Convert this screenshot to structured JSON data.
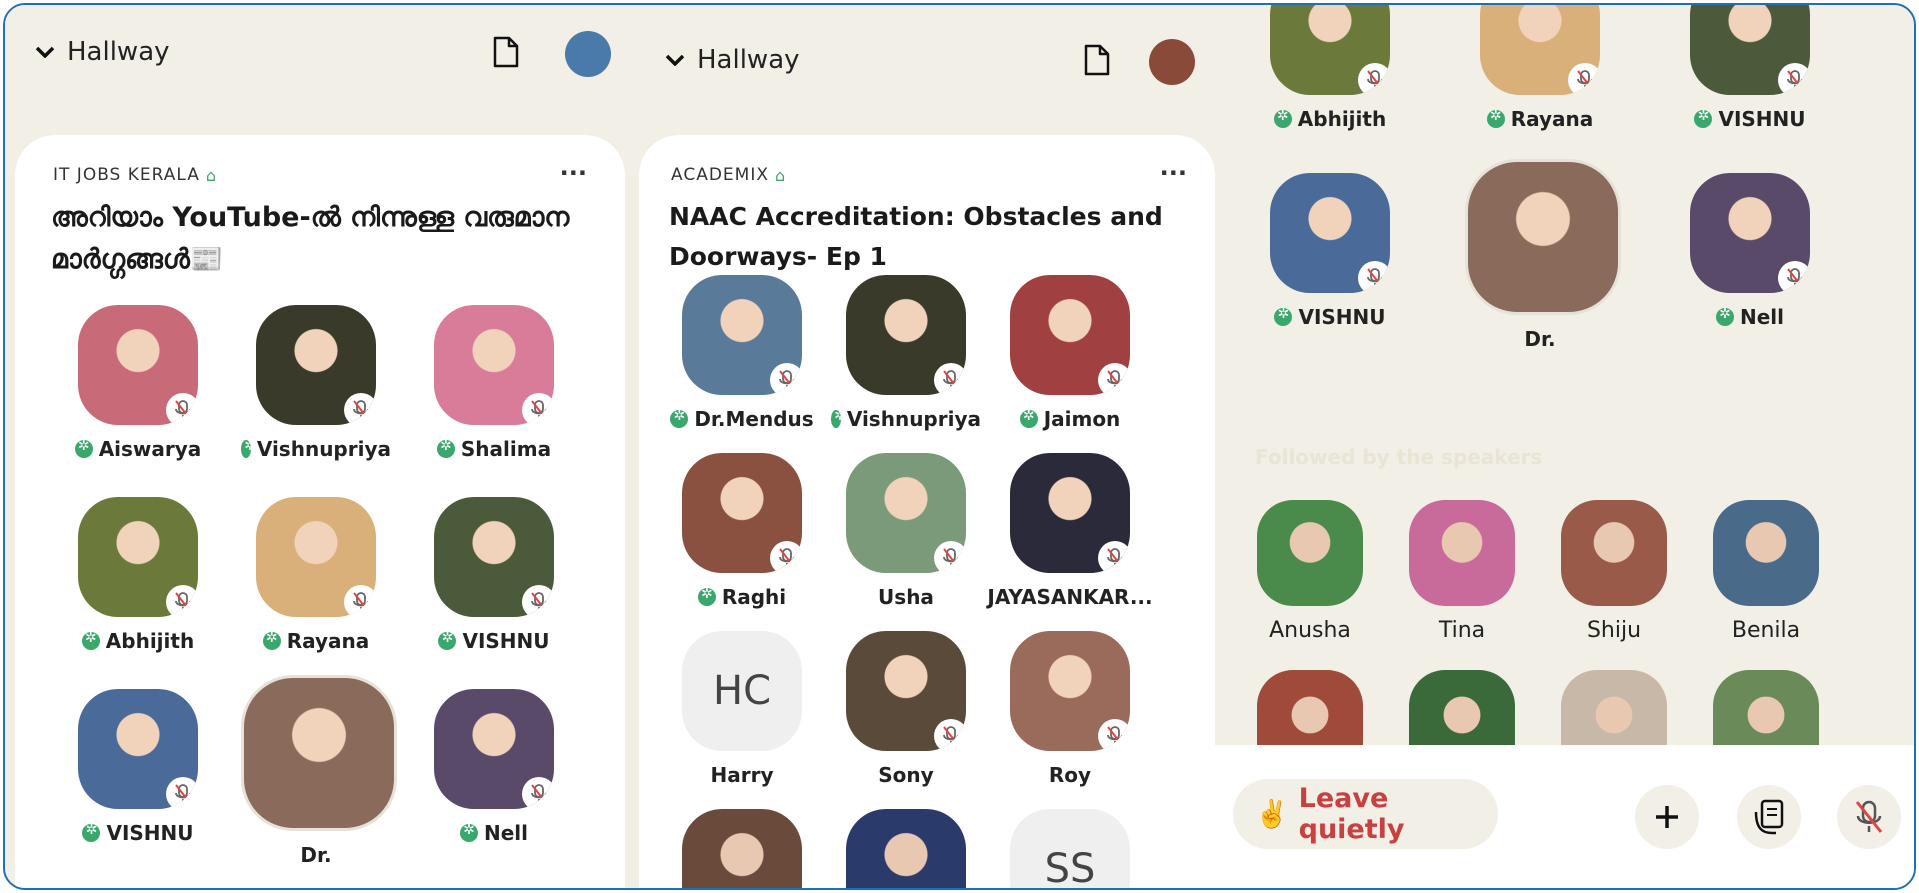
{
  "panel1": {
    "hallway": "Hallway",
    "club": "IT JOBS KERALA",
    "title": "അറിയാം YouTube-ൽ നിന്നുള്ള വരുമാന മാർഗ്ഗങ്ങൾ📰",
    "speakers": [
      {
        "name": "Aiswarya",
        "badge": true,
        "color": "#c86a78"
      },
      {
        "name": "Vishnupriya",
        "badge": true,
        "color": "#3a3a2a"
      },
      {
        "name": "Shalima",
        "badge": true,
        "color": "#d97c9a"
      },
      {
        "name": "Abhijith",
        "badge": true,
        "color": "#6b7a3a"
      },
      {
        "name": "Rayana",
        "badge": true,
        "color": "#d9b07a"
      },
      {
        "name": "VISHNU",
        "badge": true,
        "color": "#4a5a3a"
      },
      {
        "name": "VISHNU",
        "badge": true,
        "color": "#4a6a9a"
      },
      {
        "name": "Dr.",
        "badge": false,
        "color": "#8a6a5a"
      },
      {
        "name": "Nell",
        "badge": true,
        "color": "#5a4a6a"
      }
    ]
  },
  "panel2": {
    "hallway": "Hallway",
    "club": "ACADEMIX",
    "title": "NAAC Accreditation: Obstacles and Doorways- Ep 1",
    "speakers": [
      {
        "name": "Dr.Mendus",
        "badge": true,
        "color": "#5a7a9a"
      },
      {
        "name": "Vishnupriya",
        "badge": true,
        "color": "#3a3a2a"
      },
      {
        "name": "Jaimon",
        "badge": true,
        "color": "#a04040"
      },
      {
        "name": "Raghi",
        "badge": true,
        "color": "#8a5040"
      },
      {
        "name": "Usha",
        "badge": false,
        "color": "#7a9a7a"
      },
      {
        "name": "JAYASANKAR...",
        "badge": false,
        "color": "#2a2a3a"
      },
      {
        "name": "Harry",
        "badge": false,
        "initials": "HC"
      },
      {
        "name": "Sony",
        "badge": false,
        "color": "#5a4a3a"
      },
      {
        "name": "Roy",
        "badge": false,
        "color": "#9a6a5a"
      }
    ],
    "partial_initials": "SS"
  },
  "panel3": {
    "speakers": [
      {
        "name": "Abhijith",
        "badge": true,
        "color": "#6b7a3a"
      },
      {
        "name": "Rayana",
        "badge": true,
        "color": "#d9b07a"
      },
      {
        "name": "VISHNU",
        "badge": true,
        "color": "#4a5a3a"
      },
      {
        "name": "VISHNU",
        "badge": true,
        "color": "#4a6a9a"
      },
      {
        "name": "Dr.",
        "badge": false,
        "color": "#8a6a5a"
      },
      {
        "name": "Nell",
        "badge": true,
        "color": "#5a4a6a"
      }
    ],
    "followed_label": "Followed by the speakers",
    "followers": [
      {
        "name": "Anusha",
        "color": "#4a8a4a"
      },
      {
        "name": "Tina",
        "color": "#c86a9a"
      },
      {
        "name": "Shiju",
        "color": "#9a5a4a"
      },
      {
        "name": "Benila",
        "color": "#4a6a8a"
      }
    ],
    "followers_row2": [
      {
        "color": "#a04a3a"
      },
      {
        "color": "#3a6a3a"
      },
      {
        "color": "#c8b8a8"
      },
      {
        "color": "#6a8a5a"
      }
    ],
    "leave_label": "Leave quietly",
    "leave_icon": "✌️"
  }
}
